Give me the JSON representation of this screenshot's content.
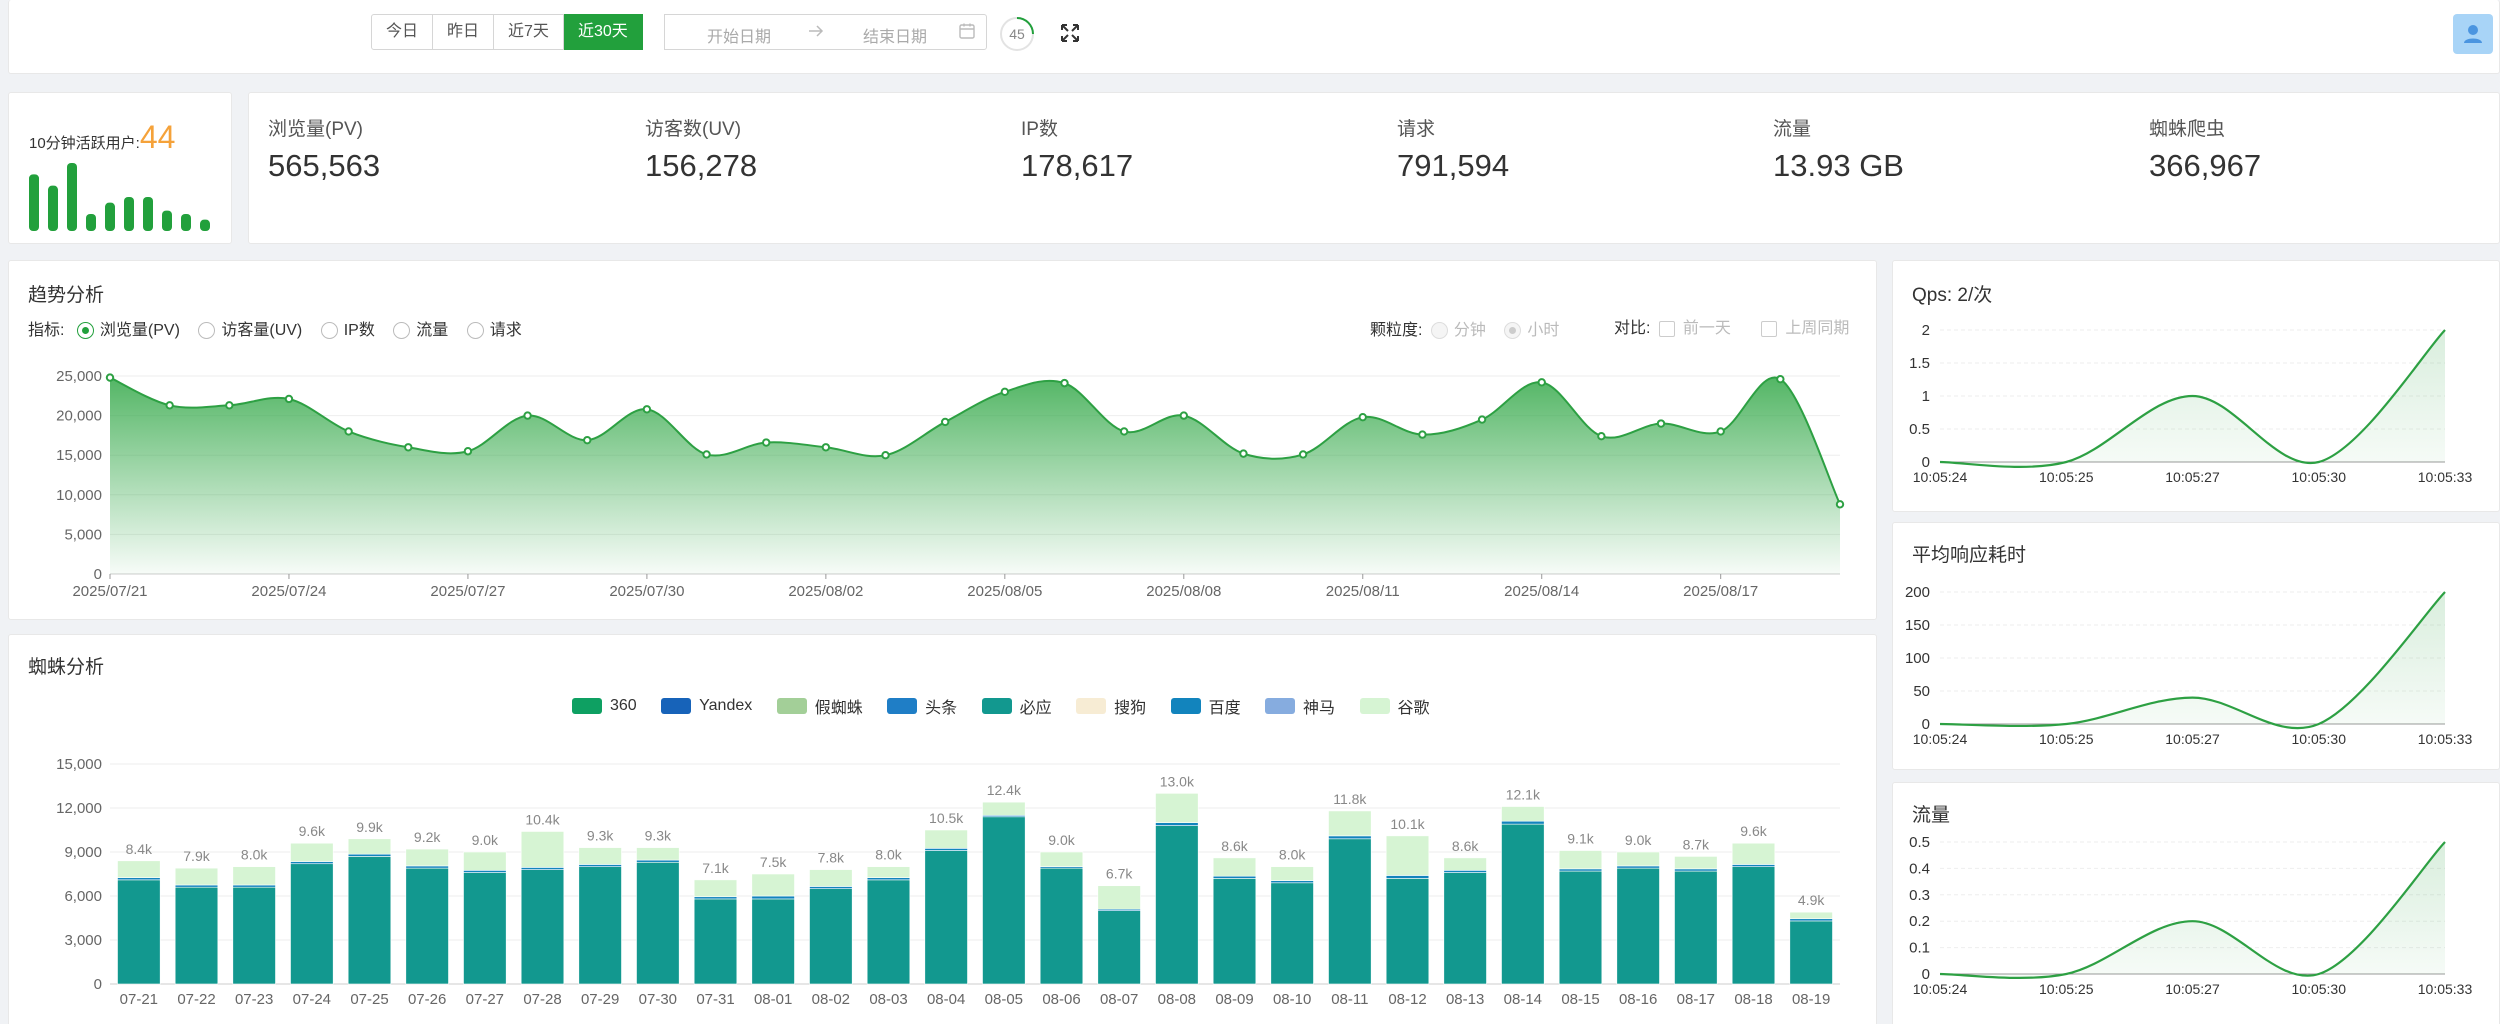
{
  "topbar": {
    "date_buttons": [
      "今日",
      "昨日",
      "近7天",
      "近30天"
    ],
    "active_index": 3,
    "start_placeholder": "开始日期",
    "end_placeholder": "结束日期",
    "refresh_seconds": "45",
    "icons": {
      "calendar": "calendar-icon",
      "fullscreen": "fullscreen-icon",
      "avatar": "user-icon",
      "arrow": "arrow-right-icon"
    }
  },
  "active": {
    "label": "10分钟活跃用户:",
    "value": "44",
    "bars": [
      5,
      4,
      6,
      1.5,
      2.5,
      3,
      3,
      1.8,
      1.5,
      1
    ]
  },
  "stats": [
    {
      "label": "浏览量(PV)",
      "value": "565,563"
    },
    {
      "label": "访客数(UV)",
      "value": "156,278"
    },
    {
      "label": "IP数",
      "value": "178,617"
    },
    {
      "label": "请求",
      "value": "791,594"
    },
    {
      "label": "流量",
      "value": "13.93 GB"
    },
    {
      "label": "蜘蛛爬虫",
      "value": "366,967"
    }
  ],
  "trend": {
    "title": "趋势分析",
    "indicator_label": "指标:",
    "indicators": [
      "浏览量(PV)",
      "访客量(UV)",
      "IP数",
      "流量",
      "请求"
    ],
    "selected_indicator": 0,
    "granularity_label": "颗粒度:",
    "granularity": [
      "分钟",
      "小时"
    ],
    "compare_label": "对比:",
    "compare": [
      "前一天",
      "上周同期"
    ]
  },
  "spider": {
    "title": "蜘蛛分析",
    "legend": [
      {
        "name": "360",
        "color": "#0ea062"
      },
      {
        "name": "Yandex",
        "color": "#1763b9"
      },
      {
        "name": "假蜘蛛",
        "color": "#a3cf98"
      },
      {
        "name": "头条",
        "color": "#1f7ec6"
      },
      {
        "name": "必应",
        "color": "#12988f"
      },
      {
        "name": "搜狗",
        "color": "#f7ecd4"
      },
      {
        "name": "百度",
        "color": "#1284bd"
      },
      {
        "name": "神马",
        "color": "#86acdf"
      },
      {
        "name": "谷歌",
        "color": "#d6f4d3"
      }
    ]
  },
  "side": {
    "qps_title": "Qps: 2/次",
    "rt_title": "平均响应耗时",
    "flow_title": "流量"
  },
  "chart_data": [
    {
      "type": "area",
      "title": "趋势分析",
      "series_name": "浏览量(PV)",
      "x": [
        "2025/07/21",
        "2025/07/22",
        "2025/07/23",
        "2025/07/24",
        "2025/07/25",
        "2025/07/26",
        "2025/07/27",
        "2025/07/28",
        "2025/07/29",
        "2025/07/30",
        "2025/07/31",
        "2025/08/01",
        "2025/08/02",
        "2025/08/03",
        "2025/08/04",
        "2025/08/05",
        "2025/08/06",
        "2025/08/07",
        "2025/08/08",
        "2025/08/09",
        "2025/08/10",
        "2025/08/11",
        "2025/08/12",
        "2025/08/13",
        "2025/08/14",
        "2025/08/15",
        "2025/08/16",
        "2025/08/17",
        "2025/08/18",
        "2025/08/19"
      ],
      "values": [
        24800,
        21300,
        21300,
        22100,
        18000,
        16000,
        15500,
        20000,
        16900,
        20800,
        15100,
        16600,
        16000,
        15000,
        19200,
        23000,
        24100,
        18000,
        20000,
        15200,
        15100,
        19800,
        17600,
        19500,
        24200,
        17400,
        19000,
        18000,
        24600,
        8800
      ],
      "x_tick_labels": [
        "2025/07/21",
        "2025/07/24",
        "2025/07/27",
        "2025/07/30",
        "2025/08/02",
        "2025/08/05",
        "2025/08/08",
        "2025/08/11",
        "2025/08/14",
        "2025/08/17"
      ],
      "ylim": [
        0,
        25000
      ],
      "y_ticks": [
        "0",
        "5,000",
        "10,000",
        "15,000",
        "20,000",
        "25,000"
      ],
      "color": "#2da043"
    },
    {
      "type": "bar",
      "title": "蜘蛛分析",
      "stacked": true,
      "categories": [
        "07-21",
        "07-22",
        "07-23",
        "07-24",
        "07-25",
        "07-26",
        "07-27",
        "07-28",
        "07-29",
        "07-30",
        "07-31",
        "08-01",
        "08-02",
        "08-03",
        "08-04",
        "08-05",
        "08-06",
        "08-07",
        "08-08",
        "08-09",
        "08-10",
        "08-11",
        "08-12",
        "08-13",
        "08-14",
        "08-15",
        "08-16",
        "08-17",
        "08-18",
        "08-19"
      ],
      "totals": [
        8400,
        7900,
        8000,
        9600,
        9900,
        9200,
        9000,
        10400,
        9300,
        9300,
        7100,
        7500,
        7800,
        8000,
        10500,
        12400,
        9000,
        6700,
        13000,
        8600,
        8000,
        11800,
        10100,
        8600,
        12100,
        9100,
        9000,
        8700,
        9600,
        4900
      ],
      "total_labels": [
        "8.4k",
        "7.9k",
        "8.0k",
        "9.6k",
        "9.9k",
        "9.2k",
        "9.0k",
        "10.4k",
        "9.3k",
        "9.3k",
        "7.1k",
        "7.5k",
        "7.8k",
        "8.0k",
        "10.5k",
        "12.4k",
        "9.0k",
        "6.7k",
        "13.0k",
        "8.6k",
        "8.0k",
        "11.8k",
        "10.1k",
        "8.6k",
        "12.1k",
        "9.1k",
        "9.0k",
        "8.7k",
        "9.6k",
        "4.9k"
      ],
      "series": [
        {
          "name": "必应",
          "values": [
            7100,
            6600,
            6600,
            8200,
            8700,
            7900,
            7600,
            7800,
            8000,
            8300,
            5800,
            5800,
            6500,
            7100,
            9100,
            11400,
            7900,
            5000,
            10800,
            7200,
            6900,
            9900,
            7200,
            7600,
            10900,
            7700,
            7900,
            7700,
            8000,
            4300
          ]
        },
        {
          "name": "百度",
          "values": [
            150,
            150,
            150,
            150,
            150,
            150,
            150,
            150,
            150,
            150,
            150,
            200,
            150,
            150,
            150,
            100,
            100,
            100,
            200,
            150,
            150,
            200,
            200,
            150,
            200,
            150,
            150,
            150,
            150,
            150
          ]
        },
        {
          "name": "谷歌",
          "values": [
            1150,
            1150,
            1250,
            1250,
            1050,
            1150,
            1250,
            2450,
            1150,
            850,
            1150,
            1500,
            1150,
            750,
            1250,
            900,
            1000,
            1600,
            2000,
            1250,
            950,
            1700,
            2700,
            850,
            1000,
            1250,
            950,
            850,
            1450,
            450
          ]
        }
      ],
      "ylim": [
        0,
        15000
      ],
      "y_ticks": [
        "0",
        "3,000",
        "6,000",
        "9,000",
        "12,000",
        "15,000"
      ]
    },
    {
      "type": "area",
      "title": "Qps: 2/次",
      "x_tick_labels": [
        "10:05:24",
        "10:05:25",
        "10:05:27",
        "10:05:30",
        "10:05:33"
      ],
      "values": [
        0,
        0,
        1,
        0,
        2
      ],
      "ylim": [
        0,
        2
      ],
      "y_ticks": [
        "0",
        "0.5",
        "1",
        "1.5",
        "2"
      ]
    },
    {
      "type": "area",
      "title": "平均响应耗时",
      "x_tick_labels": [
        "10:05:24",
        "10:05:25",
        "10:05:27",
        "10:05:30",
        "10:05:33"
      ],
      "values": [
        0,
        0,
        40,
        0,
        200
      ],
      "ylim": [
        0,
        200
      ],
      "y_ticks": [
        "0",
        "50",
        "100",
        "150",
        "200"
      ]
    },
    {
      "type": "area",
      "title": "流量",
      "x_tick_labels": [
        "10:05:24",
        "10:05:25",
        "10:05:27",
        "10:05:30",
        "10:05:33"
      ],
      "values": [
        0,
        0,
        0.2,
        0,
        0.5
      ],
      "ylim": [
        0,
        0.5
      ],
      "y_ticks": [
        "0",
        "0.1",
        "0.2",
        "0.3",
        "0.4",
        "0.5"
      ]
    }
  ]
}
